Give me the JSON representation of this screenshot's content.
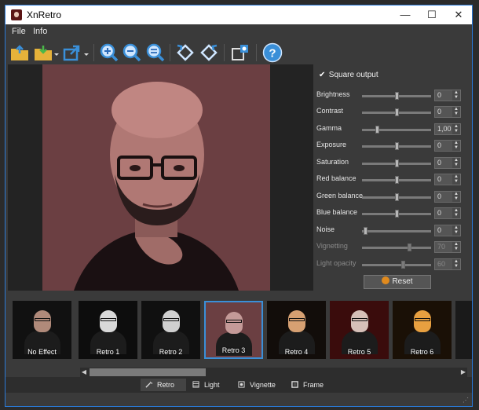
{
  "window": {
    "title": "XnRetro",
    "controls": {
      "minimize": "—",
      "maximize": "☐",
      "close": "✕"
    }
  },
  "menu": [
    "File",
    "Info"
  ],
  "toolbar": {
    "icons": [
      "open-folder-icon",
      "save-icon",
      "share-icon",
      "zoom-in-icon",
      "zoom-out-icon",
      "zoom-fit-icon",
      "rotate-left-icon",
      "rotate-right-icon",
      "settings-icon",
      "help-icon"
    ],
    "help_glyph": "?"
  },
  "panel": {
    "square_output": {
      "label": "Square output",
      "checked": true,
      "mark": "✔"
    },
    "sliders": [
      {
        "label": "Brightness",
        "value": "0",
        "fraction": 0.5,
        "enabled": true
      },
      {
        "label": "Contrast",
        "value": "0",
        "fraction": 0.5,
        "enabled": true
      },
      {
        "label": "Gamma",
        "value": "1,00",
        "fraction": 0.2,
        "enabled": true
      },
      {
        "label": "Exposure",
        "value": "0",
        "fraction": 0.5,
        "enabled": true
      },
      {
        "label": "Saturation",
        "value": "0",
        "fraction": 0.5,
        "enabled": true
      },
      {
        "label": "Red balance",
        "value": "0",
        "fraction": 0.5,
        "enabled": true
      },
      {
        "label": "Green balance",
        "value": "0",
        "fraction": 0.5,
        "enabled": true
      },
      {
        "label": "Blue balance",
        "value": "0",
        "fraction": 0.5,
        "enabled": true
      },
      {
        "label": "Noise",
        "value": "0",
        "fraction": 0.02,
        "enabled": true
      },
      {
        "label": "Vignetting",
        "value": "70",
        "fraction": 0.7,
        "enabled": false
      },
      {
        "label": "Light opacity",
        "value": "60",
        "fraction": 0.6,
        "enabled": false
      }
    ],
    "reset_label": "Reset"
  },
  "presets": [
    {
      "label": "No Effect",
      "tone": "#b08a7a",
      "bg": "#111111",
      "selected": false
    },
    {
      "label": "Retro 1",
      "tone": "#d8d8d8",
      "bg": "#0d0d0d",
      "selected": false
    },
    {
      "label": "Retro 2",
      "tone": "#cfcfcf",
      "bg": "#101010",
      "selected": false
    },
    {
      "label": "Retro 3",
      "tone": "#c49a98",
      "bg": "#6b3f42",
      "selected": true
    },
    {
      "label": "Retro 4",
      "tone": "#d6a072",
      "bg": "#120d0a",
      "selected": false
    },
    {
      "label": "Retro 5",
      "tone": "#d6c0b8",
      "bg": "#3a0c0c",
      "selected": false
    },
    {
      "label": "Retro 6",
      "tone": "#e8a040",
      "bg": "#1a1006",
      "selected": false
    }
  ],
  "tabs": [
    {
      "label": "Retro",
      "icon": "wand-icon",
      "active": true
    },
    {
      "label": "Light",
      "icon": "light-icon",
      "active": false
    },
    {
      "label": "Vignette",
      "icon": "vignette-icon",
      "active": false
    },
    {
      "label": "Frame",
      "icon": "frame-icon",
      "active": false
    }
  ],
  "scroll_glyphs": {
    "left": "◀",
    "right": "▶"
  },
  "spin_glyphs": {
    "up": "▲",
    "down": "▼"
  },
  "colors": {
    "accent": "#3a8fd8",
    "reset_icon": "#e08a1e",
    "photo_bg": "#6b3f42"
  }
}
